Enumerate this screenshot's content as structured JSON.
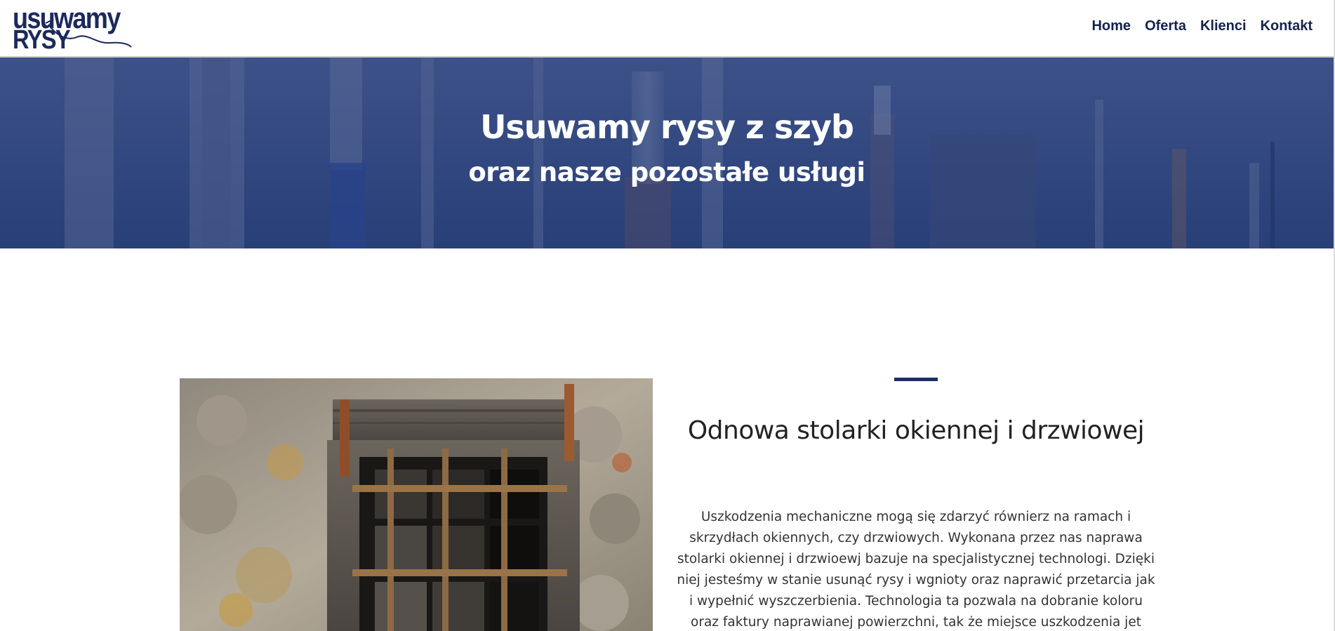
{
  "header": {
    "logo": {
      "line1": "usuwamy",
      "line2": "RYSY"
    },
    "nav": [
      {
        "label": "Home"
      },
      {
        "label": "Oferta"
      },
      {
        "label": "Klienci"
      },
      {
        "label": "Kontakt"
      }
    ]
  },
  "hero": {
    "title": "Usuwamy rysy z szyb",
    "subtitle": "oraz nasze pozostałe usługi"
  },
  "section": {
    "title": "Odnowa stolarki okiennej i drzwiowej",
    "text": "Uszkodzenia mechaniczne mogą się zdarzyć równierz na ramach i skrzydłach okiennych, czy drzwiowych. Wykonana przez nas naprawa stolarki okiennej i drzwioewj bazuje na specjalistycznej technologi. Dzięki niej jesteśmy w stanie usunąć rysy i wgnioty oraz naprawić przetarcia jak i wypełnić wyszczerbienia. Technologia ta pozwala na dobranie koloru oraz faktury naprawianej powierzchni, tak że miejsce uszkodzenia jet praktycznie nie"
  },
  "colors": {
    "brand_navy": "#1b2a5c",
    "hero_overlay": "#34497a",
    "accent_bar": "#1c2e5e"
  }
}
